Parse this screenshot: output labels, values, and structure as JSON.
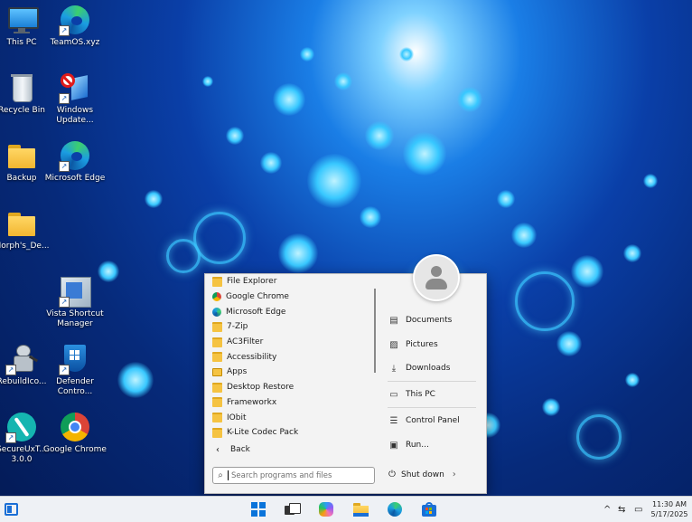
{
  "desktop": {
    "icons": [
      {
        "label": "This PC",
        "icon": "monitor-icon"
      },
      {
        "label": "TeamOS.xyz",
        "icon": "edge-icon"
      },
      {
        "label": "Recycle Bin",
        "icon": "recycle-bin-icon"
      },
      {
        "label": "Windows Update...",
        "icon": "windows-update-icon"
      },
      {
        "label": "Backup",
        "icon": "folder-icon"
      },
      {
        "label": "Microsoft Edge",
        "icon": "edge-icon"
      },
      {
        "label": "Morph's_De...",
        "icon": "folder-icon"
      },
      {
        "label": "Vista Shortcut Manager",
        "icon": "vista-shortcut-manager-icon"
      },
      {
        "label": "RebuildIco...",
        "icon": "robot-icon"
      },
      {
        "label": "Defender Contro...",
        "icon": "defender-icon"
      },
      {
        "label": "SecureUxT... 3.0.0",
        "icon": "brush-icon"
      },
      {
        "label": "Google Chrome",
        "icon": "chrome-icon"
      }
    ]
  },
  "start_menu": {
    "programs": [
      {
        "label": "File Explorer",
        "icon": "folder-icon"
      },
      {
        "label": "Google Chrome",
        "icon": "chrome-icon"
      },
      {
        "label": "Microsoft Edge",
        "icon": "edge-icon"
      },
      {
        "label": "7-Zip",
        "icon": "folder-icon"
      },
      {
        "label": "AC3Filter",
        "icon": "folder-icon"
      },
      {
        "label": "Accessibility",
        "icon": "folder-icon"
      },
      {
        "label": "Apps",
        "icon": "apps-icon"
      },
      {
        "label": "Desktop Restore",
        "icon": "folder-icon"
      },
      {
        "label": "Frameworkx",
        "icon": "folder-icon"
      },
      {
        "label": "IObit",
        "icon": "folder-icon"
      },
      {
        "label": "K-Lite Codec Pack",
        "icon": "folder-icon"
      }
    ],
    "back_label": "Back",
    "right_items": [
      {
        "label": "Documents",
        "icon": "document-icon"
      },
      {
        "label": "Pictures",
        "icon": "picture-icon"
      },
      {
        "label": "Downloads",
        "icon": "download-icon"
      },
      {
        "label": "This PC",
        "icon": "computer-icon"
      },
      {
        "label": "Control Panel",
        "icon": "control-panel-icon"
      },
      {
        "label": "Run...",
        "icon": "run-icon"
      }
    ],
    "search_placeholder": "Search programs and files",
    "shutdown_label": "Shut down"
  },
  "taskbar": {
    "apps": [
      "start-icon",
      "task-view-icon",
      "copilot-icon",
      "file-explorer-icon",
      "edge-icon",
      "store-icon"
    ],
    "clock_time": "11:30 AM",
    "clock_date": "5/17/2025"
  },
  "colors": {
    "folder": "#f5c342",
    "accent": "#0067c0",
    "taskbar": "#eef1f5",
    "menu_bg": "#f3f3f3"
  }
}
